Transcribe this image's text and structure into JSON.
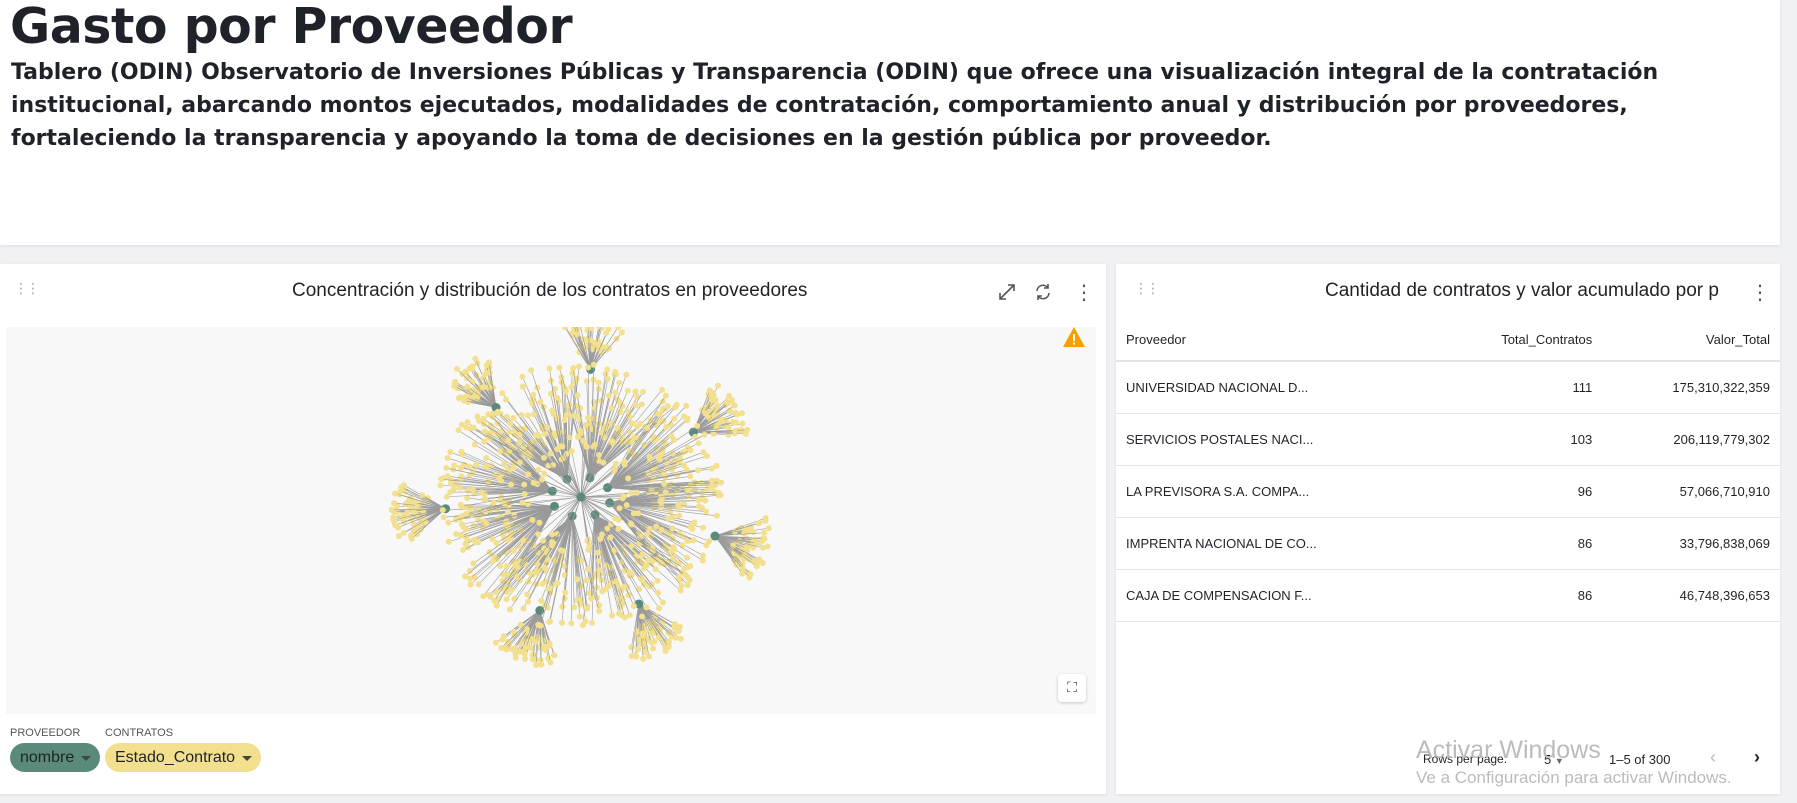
{
  "header": {
    "title": "Gasto por Proveedor",
    "description": "Tablero (ODIN) Observatorio de Inversiones Públicas y Transparencia (ODIN) que ofrece una visualización integral de la contratación institucional, abarcando montos ejecutados, modalidades de contratación, comportamiento anual y distribución por proveedores, fortaleciendo la transparencia y apoyando la toma de decisiones en la gestión pública por proveedor."
  },
  "graph_card": {
    "title": "Concentración y distribución de los contratos en proveedores",
    "legend": [
      {
        "label": "PROVEEDOR",
        "value": "nombre",
        "color": "#5a8a7a"
      },
      {
        "label": "CONTRATOS",
        "value": "Estado_Contrato",
        "color": "#f2e08f"
      }
    ],
    "warning_color": "#f5a000",
    "icons": [
      "expand-icon",
      "refresh-icon",
      "more-vert-icon",
      "warning-icon",
      "fit-view-icon"
    ]
  },
  "table_card": {
    "title": "Cantidad de contratos y valor acumulado por p",
    "columns": [
      "Proveedor",
      "Total_Contratos",
      "Valor_Total"
    ],
    "rows": [
      [
        "UNIVERSIDAD NACIONAL D...",
        "111",
        "175,310,322,359"
      ],
      [
        "SERVICIOS POSTALES NACI...",
        "103",
        "206,119,779,302"
      ],
      [
        "LA PREVISORA S.A. COMPA...",
        "96",
        "57,066,710,910"
      ],
      [
        "IMPRENTA NACIONAL DE CO...",
        "86",
        "33,796,838,069"
      ],
      [
        "CAJA DE COMPENSACION F...",
        "86",
        "46,748,396,653"
      ]
    ],
    "pagination": {
      "rows_per_page_label": "Rows per page:",
      "rows_per_page": "5",
      "range": "1–5 of 300"
    }
  },
  "watermark": {
    "line1": "Activar Windows",
    "line2": "Ve a Configuración para activar Windows."
  }
}
